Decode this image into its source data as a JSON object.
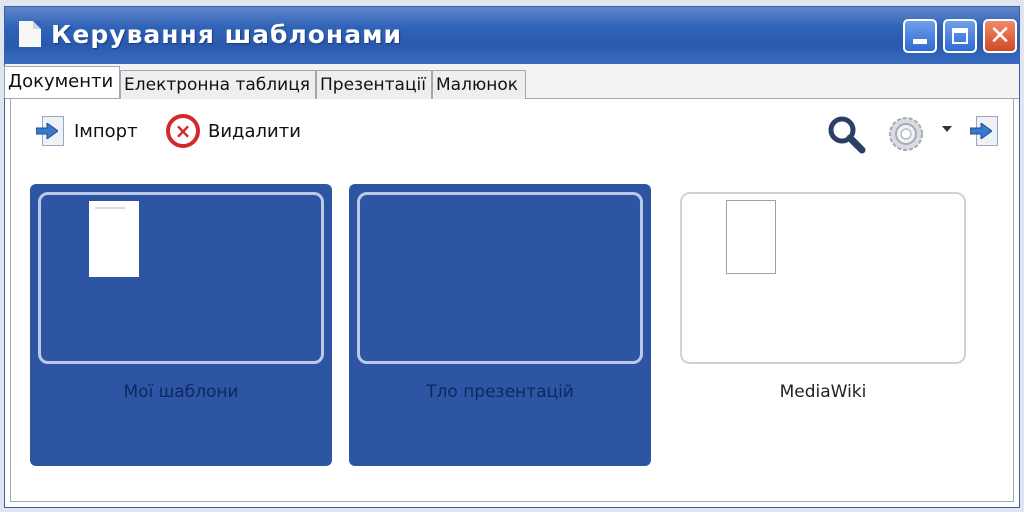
{
  "window": {
    "title": "Керування шаблонами",
    "controls": [
      "minimize",
      "maximize",
      "close"
    ]
  },
  "tabs": [
    {
      "label": "Документи",
      "active": true
    },
    {
      "label": "Електронна таблиця",
      "active": false
    },
    {
      "label": "Презентації",
      "active": false
    },
    {
      "label": "Малюнок",
      "active": false
    }
  ],
  "toolbar": {
    "import_label": "Імпорт",
    "delete_label": "Видалити",
    "icons": [
      "import-icon",
      "delete-icon",
      "search-icon",
      "gear-icon",
      "chevron-down-icon",
      "export-icon"
    ]
  },
  "folders": [
    {
      "label": "Мої шаблони",
      "selected": true
    },
    {
      "label": "Тло презентацій",
      "selected": true
    },
    {
      "label": "MediaWiki",
      "selected": false
    }
  ],
  "colors": {
    "titlebar": "#2f63b8",
    "selection": "#2d55a3",
    "close_button": "#d04a23",
    "delete_icon": "#d22a2a"
  }
}
